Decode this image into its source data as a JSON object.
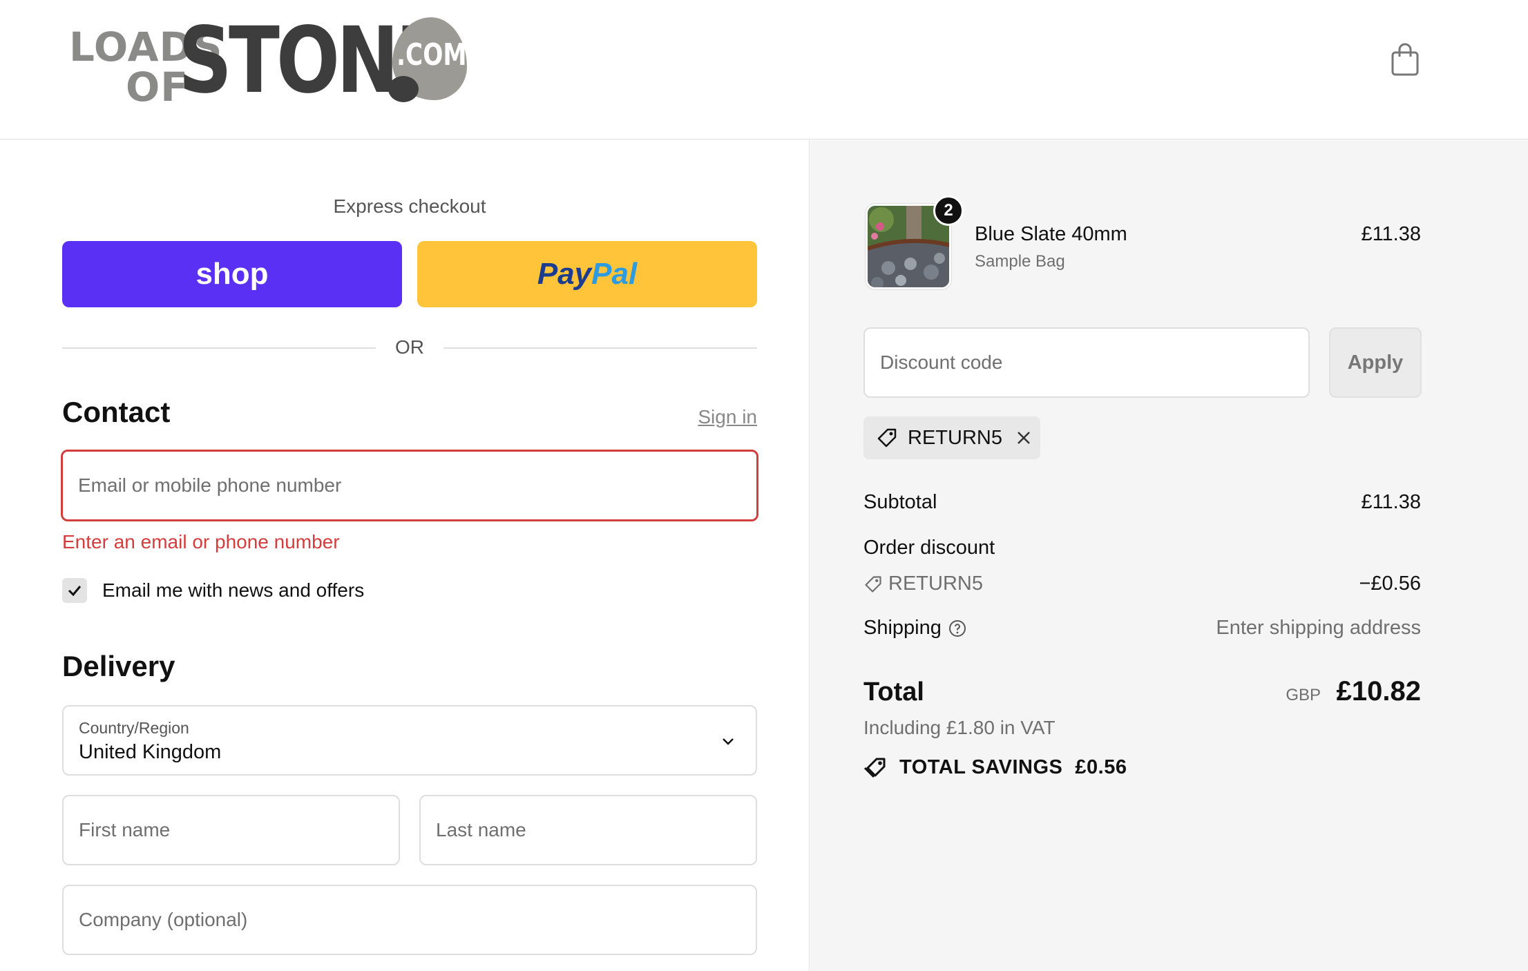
{
  "header": {
    "logo": {
      "line1": "LOADS",
      "line2": "OF",
      "main": "STONE",
      "suffix": ".COM"
    },
    "cart_icon": "shopping-bag-icon"
  },
  "checkout": {
    "express_label": "Express checkout",
    "shop_pay_label": "shop",
    "paypal_pay": "Pay",
    "paypal_pal": "Pal",
    "or_label": "OR",
    "contact": {
      "heading": "Contact",
      "sign_in": "Sign in",
      "email_placeholder": "Email or mobile phone number",
      "error": "Enter an email or phone number",
      "newsletter_label": "Email me with news and offers",
      "newsletter_checked": true
    },
    "delivery": {
      "heading": "Delivery",
      "country_label": "Country/Region",
      "country_value": "United Kingdom",
      "first_name_placeholder": "First name",
      "last_name_placeholder": "Last name",
      "company_placeholder": "Company (optional)"
    }
  },
  "summary": {
    "item": {
      "quantity": "2",
      "name": "Blue Slate 40mm",
      "variant": "Sample Bag",
      "price": "£11.38"
    },
    "discount_placeholder": "Discount code",
    "apply_label": "Apply",
    "applied_code": "RETURN5",
    "subtotal_label": "Subtotal",
    "subtotal_value": "£11.38",
    "order_discount_label": "Order discount",
    "order_discount_code": "RETURN5",
    "order_discount_value": "−£0.56",
    "shipping_label": "Shipping",
    "shipping_value": "Enter shipping address",
    "total_label": "Total",
    "currency": "GBP",
    "total_value": "£10.82",
    "vat_text": "Including £1.80 in VAT",
    "savings_label": "TOTAL SAVINGS",
    "savings_value": "£0.56"
  },
  "colors": {
    "shop_pay": "#5a31f4",
    "paypal": "#ffc439",
    "error": "#d43d3d",
    "summary_bg": "#f5f5f5"
  }
}
